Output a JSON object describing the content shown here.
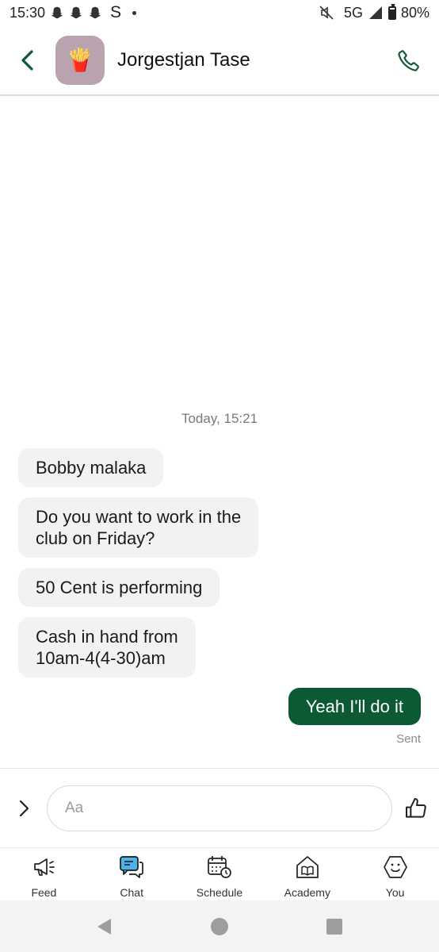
{
  "status_bar": {
    "time": "15:30",
    "extra_app": "S",
    "network": "5G",
    "battery": "80%",
    "battery_level": 0.8
  },
  "header": {
    "contact_name": "Jorgestjan Tase",
    "avatar_emoji": "🍟",
    "avatar_color": "#b9a3ae"
  },
  "conversation": {
    "timestamp": "Today, 15:21",
    "incoming": [
      {
        "lines": [
          "Bobby malaka"
        ]
      },
      {
        "lines": [
          "Do you want to work in the",
          "club on Friday?"
        ]
      },
      {
        "lines": [
          "50 Cent is performing"
        ]
      },
      {
        "lines": [
          "Cash in hand from",
          "10am-4(4-30)am"
        ]
      }
    ],
    "outgoing": {
      "text": "Yeah I'll do it",
      "status": "Sent"
    }
  },
  "composer": {
    "placeholder": "Aa",
    "value": ""
  },
  "bottom_nav": {
    "items": [
      {
        "label": "Feed",
        "icon": "megaphone-icon"
      },
      {
        "label": "Chat",
        "icon": "chat-icon",
        "active": true
      },
      {
        "label": "Schedule",
        "icon": "calendar-clock-icon"
      },
      {
        "label": "Academy",
        "icon": "book-house-icon"
      },
      {
        "label": "You",
        "icon": "smiley-icon"
      }
    ]
  },
  "colors": {
    "accent": "#0b5a34",
    "chat_active": "#4bb3e6",
    "bubble_in": "#f2f2f2"
  }
}
